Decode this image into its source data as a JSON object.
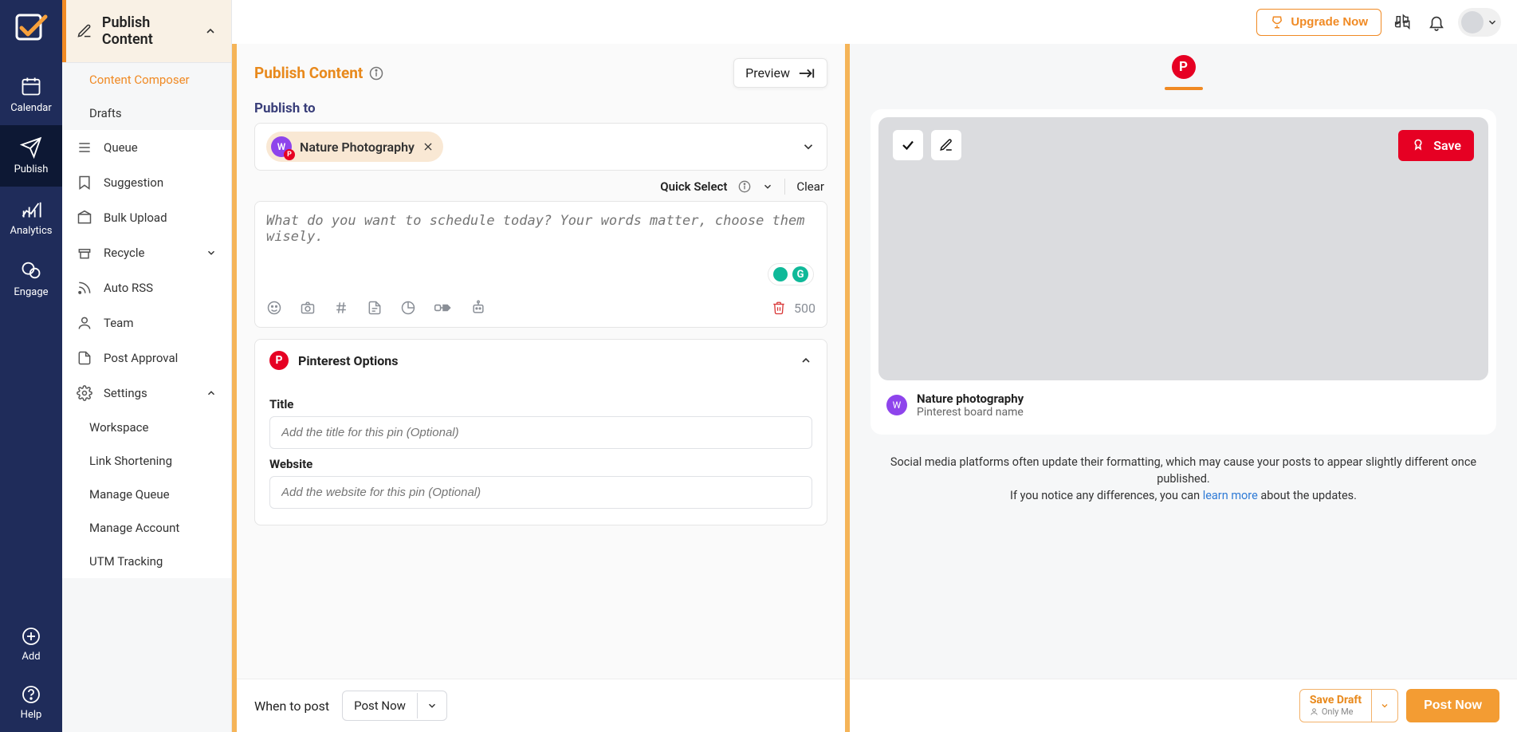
{
  "rail": {
    "calendar": "Calendar",
    "publish": "Publish",
    "analytics": "Analytics",
    "engage": "Engage",
    "add": "Add",
    "help": "Help"
  },
  "topbar": {
    "upgrade": "Upgrade Now"
  },
  "sidebar": {
    "header": "Publish Content",
    "items": [
      {
        "label": "Content Composer"
      },
      {
        "label": "Drafts"
      },
      {
        "label": "Queue"
      },
      {
        "label": "Suggestion"
      },
      {
        "label": "Bulk Upload"
      },
      {
        "label": "Recycle"
      },
      {
        "label": "Auto RSS"
      },
      {
        "label": "Team"
      },
      {
        "label": "Post Approval"
      },
      {
        "label": "Settings"
      },
      {
        "label": "Workspace"
      },
      {
        "label": "Link Shortening"
      },
      {
        "label": "Manage Queue"
      },
      {
        "label": "Manage Account"
      },
      {
        "label": "UTM Tracking"
      }
    ]
  },
  "main": {
    "title": "Publish Content",
    "preview": "Preview",
    "publish_to_label": "Publish to",
    "account_chip": "Nature Photography",
    "quick_select": "Quick Select",
    "clear": "Clear",
    "composer_placeholder": "What do you want to schedule today? Your words matter, choose them wisely.",
    "char_count": "500",
    "pinterest_header": "Pinterest Options",
    "pin_title_label": "Title",
    "pin_title_placeholder": "Add the title for this pin (Optional)",
    "pin_website_label": "Website",
    "pin_website_placeholder": "Add the website for this pin (Optional)",
    "when_label": "When to post",
    "when_value": "Post Now"
  },
  "preview": {
    "save": "Save",
    "title": "Nature photography",
    "subtitle": "Pinterest board name",
    "note1": "Social media platforms often update their formatting, which may cause your posts to appear slightly different once published.",
    "note2a": "If you notice any differences, you can ",
    "note2_link": "learn more",
    "note2b": " about the updates.",
    "save_draft": "Save Draft",
    "only_me": "Only Me",
    "post_now": "Post Now"
  }
}
